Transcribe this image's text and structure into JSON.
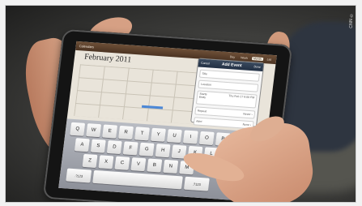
{
  "photo_credit": "CNN ©",
  "calendar": {
    "toolbar_title": "Calendars",
    "tabs": [
      "Day",
      "Week",
      "Month",
      "List"
    ],
    "selected_tab": "Month",
    "month_title": "February 2011"
  },
  "add_event": {
    "cancel": "Cancel",
    "title": "Add Event",
    "done": "Done",
    "rows": [
      {
        "label": "Title",
        "value": ""
      },
      {
        "label": "Location",
        "value": ""
      },
      {
        "label": "Starts\nEnds",
        "value": "Thu Feb 17 6:00 PM"
      },
      {
        "label": "Repeat",
        "value": "Never ›"
      },
      {
        "label": "Alert",
        "value": "None ›"
      }
    ]
  },
  "keyboard": {
    "row1": [
      "Q",
      "W",
      "E",
      "R",
      "T",
      "Y",
      "U",
      "I",
      "O",
      "P"
    ],
    "row2": [
      "A",
      "S",
      "D",
      "F",
      "G",
      "H",
      "J",
      "K",
      "L"
    ],
    "row3": [
      "Z",
      "X",
      "C",
      "V",
      "B",
      "N",
      "M"
    ],
    "row4": [
      ".?123",
      "",
      ".?123"
    ]
  },
  "colors": {
    "toolbar": "#5c3f2b",
    "event": "#4b87d6",
    "skin": "#d7a284"
  }
}
